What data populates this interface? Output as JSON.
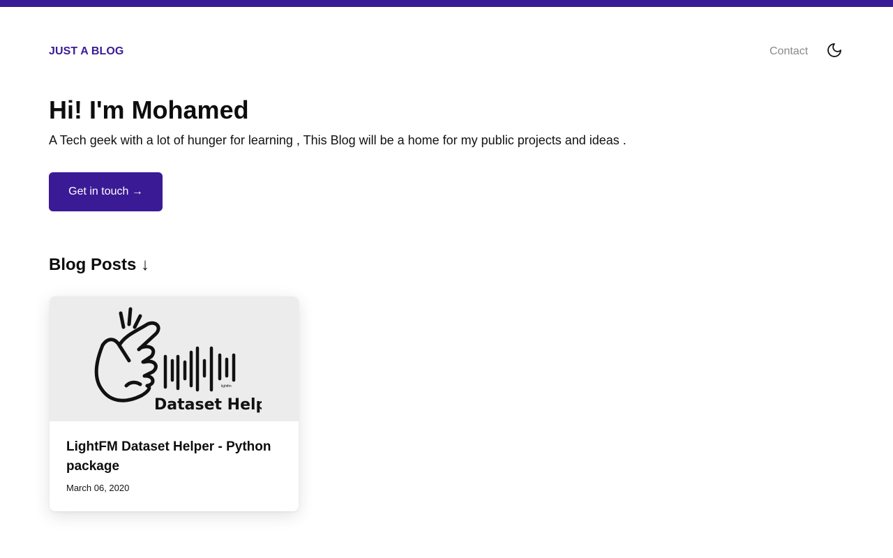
{
  "header": {
    "site_title": "JUST A BLOG",
    "nav": {
      "contact_label": "Contact"
    },
    "theme_toggle_icon": "moon-icon"
  },
  "hero": {
    "title": "Hi! I'm Mohamed",
    "subtitle": "A Tech geek with a lot of hunger for learning , This Blog will be a home for my public projects and ideas .",
    "cta_label": "Get in touch →"
  },
  "blog": {
    "section_title": "Blog Posts ↓",
    "posts": [
      {
        "title": "LightFM Dataset Helper - Python package",
        "date": "March 06, 2020",
        "thumbnail": {
          "logo_text": "Dataset Helper",
          "wave_text": "lightfm",
          "icon": "snapping-hand-icon"
        }
      }
    ]
  },
  "colors": {
    "accent": "#3b1a96",
    "nav_muted": "#8a8a8a",
    "thumb_bg": "#ececec"
  }
}
